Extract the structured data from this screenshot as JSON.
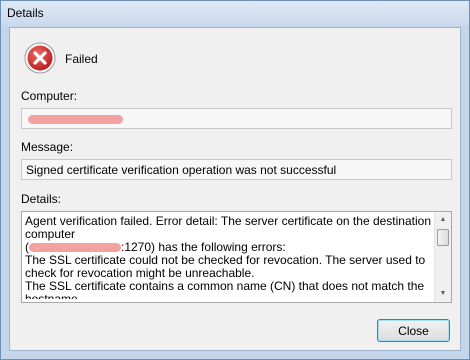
{
  "window": {
    "title": "Details"
  },
  "status": {
    "icon": "error-x-icon",
    "label": "Failed",
    "color": "#d32f2f"
  },
  "computer": {
    "label": "Computer:",
    "value": ""
  },
  "message": {
    "label": "Message:",
    "value": "Signed certificate verification operation was not successful"
  },
  "details": {
    "label": "Details:",
    "line1": "Agent verification failed. Error detail: The server certificate on the destination computer",
    "line2_prefix": "(",
    "line2_suffix": ":1270) has the following errors:",
    "lines_rest": "The SSL certificate could not be checked for revocation. The server used to check for revocation might be unreachable.\nThe SSL certificate contains a common name (CN) that does not match the hostname."
  },
  "buttons": {
    "close": "Close"
  }
}
